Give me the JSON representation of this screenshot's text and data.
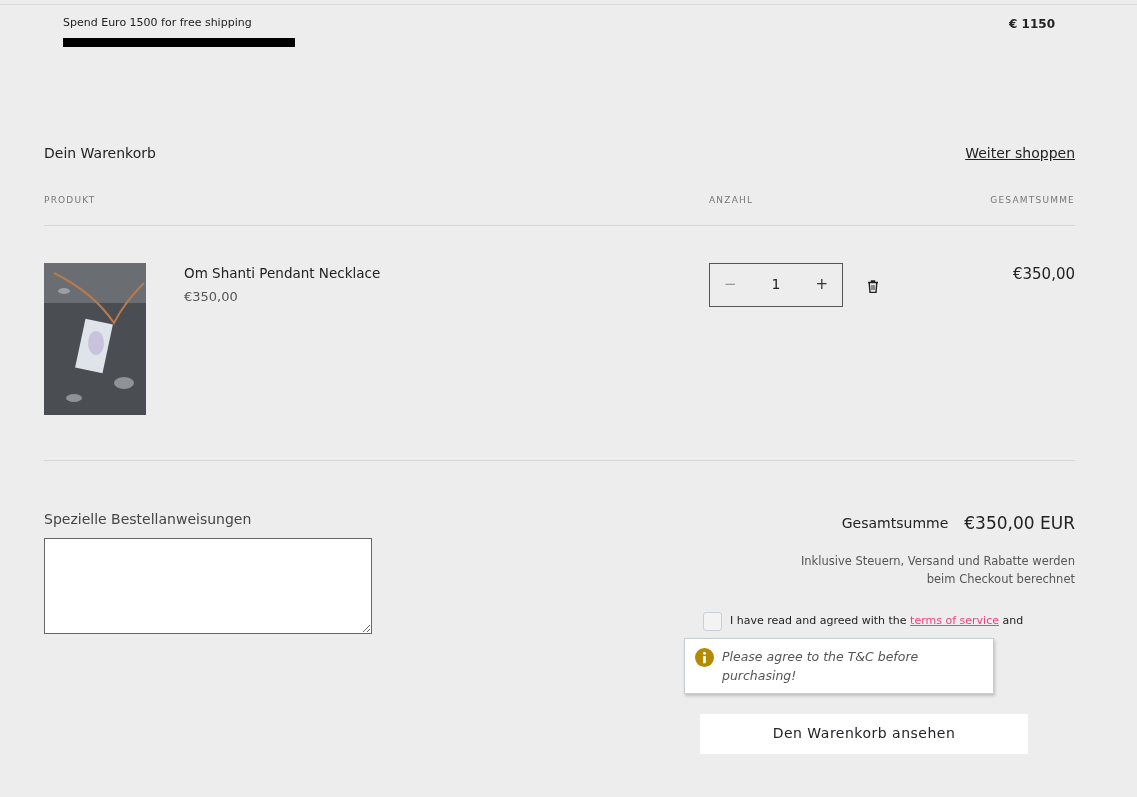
{
  "shipping_bar": {
    "message": "Spend Euro 1500 for free shipping",
    "amount": "€ 1150"
  },
  "cart": {
    "title": "Dein Warenkorb",
    "continue_link": "Weiter shoppen",
    "columns": [
      "PRODUKT",
      "ANZAHL",
      "GESAMTSUMME"
    ],
    "items": [
      {
        "name": "Om Shanti Pendant Necklace",
        "price": "€350,00",
        "quantity": "1",
        "minus": "−",
        "plus": "+",
        "total": "€350,00"
      }
    ]
  },
  "notes": {
    "label": "Spezielle Bestellanweisungen"
  },
  "summary": {
    "total_label": "Gesamtsumme",
    "total_value": "€350,00 EUR",
    "tax_note": "Inklusive Steuern, Versand und Rabatte werden beim Checkout berechnet",
    "terms": {
      "checked": false,
      "text_before": "I have read and agreed with the",
      "terms_link": "terms of service",
      "text_middle": "and"
    },
    "tooltip": "Please agree to the T&C before purchasing!",
    "view_cart_button": "Den Warenkorb ansehen"
  }
}
